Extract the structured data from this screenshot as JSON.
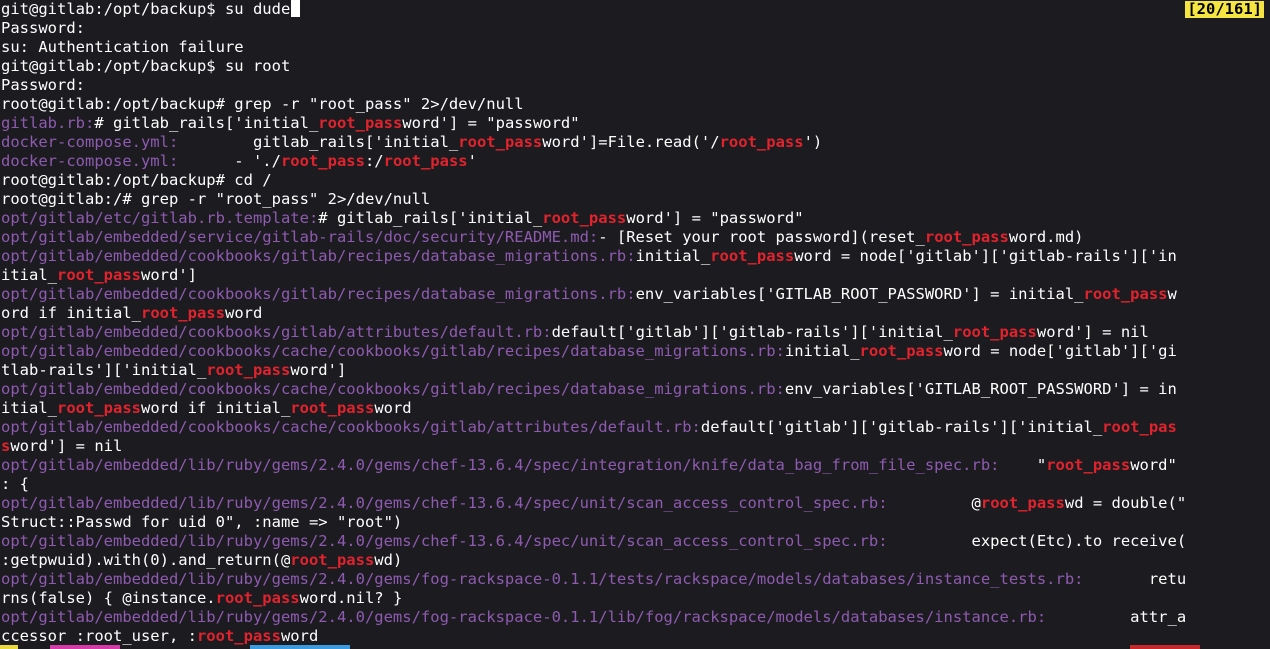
{
  "terminal": {
    "badge": "[20/161]",
    "lines": [
      [
        {
          "t": "git@gitlab:/opt/backup$ su dude"
        }
      ],
      [
        {
          "t": "Password:"
        }
      ],
      [
        {
          "t": "su: Authentication failure"
        }
      ],
      [
        {
          "t": "git@gitlab:/opt/backup$ su root"
        }
      ],
      [
        {
          "t": "Password:"
        }
      ],
      [
        {
          "t": "root@gitlab:/opt/backup# grep -r \"root_pass\" 2>/dev/null"
        }
      ],
      [
        {
          "t": "gitlab.rb:",
          "c": "path"
        },
        {
          "t": "# gitlab_rails['initial_"
        },
        {
          "t": "root_pass",
          "c": "hl"
        },
        {
          "t": "word'] = \"password\""
        }
      ],
      [
        {
          "t": "docker-compose.yml:",
          "c": "path"
        },
        {
          "t": "        gitlab_rails['initial_"
        },
        {
          "t": "root_pass",
          "c": "hl"
        },
        {
          "t": "word']=File.read('/"
        },
        {
          "t": "root_pass",
          "c": "hl"
        },
        {
          "t": "')"
        }
      ],
      [
        {
          "t": "docker-compose.yml:",
          "c": "path"
        },
        {
          "t": "      - './"
        },
        {
          "t": "root_pass",
          "c": "hl"
        },
        {
          "t": ":/"
        },
        {
          "t": "root_pass",
          "c": "hl"
        },
        {
          "t": "'"
        }
      ],
      [
        {
          "t": "root@gitlab:/opt/backup# cd /"
        }
      ],
      [
        {
          "t": "root@gitlab:/# grep -r \"root_pass\" 2>/dev/null"
        }
      ],
      [
        {
          "t": "opt/gitlab/etc/gitlab.rb.template:",
          "c": "path"
        },
        {
          "t": "# gitlab_rails['initial_"
        },
        {
          "t": "root_pass",
          "c": "hl"
        },
        {
          "t": "word'] = \"password\""
        }
      ],
      [
        {
          "t": "opt/gitlab/embedded/service/gitlab-rails/doc/security/README.md:",
          "c": "path"
        },
        {
          "t": "- [Reset your root password](reset_"
        },
        {
          "t": "root_pass",
          "c": "hl"
        },
        {
          "t": "word.md)"
        }
      ],
      [
        {
          "t": "opt/gitlab/embedded/cookbooks/gitlab/recipes/database_migrations.rb:",
          "c": "path"
        },
        {
          "t": "initial_"
        },
        {
          "t": "root_pass",
          "c": "hl"
        },
        {
          "t": "word = node['gitlab']['gitlab-rails']['in"
        }
      ],
      [
        {
          "t": "itial_"
        },
        {
          "t": "root_pass",
          "c": "hl"
        },
        {
          "t": "word']"
        }
      ],
      [
        {
          "t": "opt/gitlab/embedded/cookbooks/gitlab/recipes/database_migrations.rb:",
          "c": "path"
        },
        {
          "t": "env_variables['GITLAB_ROOT_PASSWORD'] = initial_"
        },
        {
          "t": "root_pass",
          "c": "hl"
        },
        {
          "t": "w"
        }
      ],
      [
        {
          "t": "ord if initial_"
        },
        {
          "t": "root_pass",
          "c": "hl"
        },
        {
          "t": "word"
        }
      ],
      [
        {
          "t": "opt/gitlab/embedded/cookbooks/gitlab/attributes/default.rb:",
          "c": "path"
        },
        {
          "t": "default['gitlab']['gitlab-rails']['initial_"
        },
        {
          "t": "root_pass",
          "c": "hl"
        },
        {
          "t": "word'] = nil"
        }
      ],
      [
        {
          "t": "opt/gitlab/embedded/cookbooks/cache/cookbooks/gitlab/recipes/database_migrations.rb:",
          "c": "path"
        },
        {
          "t": "initial_"
        },
        {
          "t": "root_pass",
          "c": "hl"
        },
        {
          "t": "word = node['gitlab']['gi"
        }
      ],
      [
        {
          "t": "tlab-rails']['initial_"
        },
        {
          "t": "root_pass",
          "c": "hl"
        },
        {
          "t": "word']"
        }
      ],
      [
        {
          "t": "opt/gitlab/embedded/cookbooks/cache/cookbooks/gitlab/recipes/database_migrations.rb:",
          "c": "path"
        },
        {
          "t": "env_variables['GITLAB_ROOT_PASSWORD'] = in"
        }
      ],
      [
        {
          "t": "itial_"
        },
        {
          "t": "root_pass",
          "c": "hl"
        },
        {
          "t": "word if initial_"
        },
        {
          "t": "root_pass",
          "c": "hl"
        },
        {
          "t": "word"
        }
      ],
      [
        {
          "t": "opt/gitlab/embedded/cookbooks/cache/cookbooks/gitlab/attributes/default.rb:",
          "c": "path"
        },
        {
          "t": "default['gitlab']['gitlab-rails']['initial_"
        },
        {
          "t": "root_pas",
          "c": "hl"
        }
      ],
      [
        {
          "t": "s",
          "c": "hl"
        },
        {
          "t": "word'] = nil"
        }
      ],
      [
        {
          "t": "opt/gitlab/embedded/lib/ruby/gems/2.4.0/gems/chef-13.6.4/spec/integration/knife/data_bag_from_file_spec.rb:",
          "c": "path"
        },
        {
          "t": "    \""
        },
        {
          "t": "root_pass",
          "c": "hl"
        },
        {
          "t": "word\""
        }
      ],
      [
        {
          "t": ": {"
        }
      ],
      [
        {
          "t": "opt/gitlab/embedded/lib/ruby/gems/2.4.0/gems/chef-13.6.4/spec/unit/scan_access_control_spec.rb:",
          "c": "path"
        },
        {
          "t": "         @"
        },
        {
          "t": "root_pass",
          "c": "hl"
        },
        {
          "t": "wd = double(\""
        }
      ],
      [
        {
          "t": "Struct::Passwd for uid 0\", :name => \"root\")"
        }
      ],
      [
        {
          "t": "opt/gitlab/embedded/lib/ruby/gems/2.4.0/gems/chef-13.6.4/spec/unit/scan_access_control_spec.rb:",
          "c": "path"
        },
        {
          "t": "         expect(Etc).to receive("
        }
      ],
      [
        {
          "t": ":getpwuid).with(0).and_return(@"
        },
        {
          "t": "root_pass",
          "c": "hl"
        },
        {
          "t": "wd)"
        }
      ],
      [
        {
          "t": "opt/gitlab/embedded/lib/ruby/gems/2.4.0/gems/fog-rackspace-0.1.1/tests/rackspace/models/databases/instance_tests.rb:",
          "c": "path"
        },
        {
          "t": "       retu"
        }
      ],
      [
        {
          "t": "rns(false) { @instance."
        },
        {
          "t": "root_pass",
          "c": "hl"
        },
        {
          "t": "word.nil? }"
        }
      ],
      [
        {
          "t": "opt/gitlab/embedded/lib/ruby/gems/2.4.0/gems/fog-rackspace-0.1.1/lib/fog/rackspace/models/databases/instance.rb:",
          "c": "path"
        },
        {
          "t": "         attr_a"
        }
      ],
      [
        {
          "t": "ccessor :root_user, :"
        },
        {
          "t": "root_pass",
          "c": "hl"
        },
        {
          "t": "word"
        }
      ]
    ]
  },
  "colors": {
    "background": "#1c1b20",
    "path": "#8e5bb0",
    "highlight": "#e0232d",
    "badge": "#f5e542"
  }
}
